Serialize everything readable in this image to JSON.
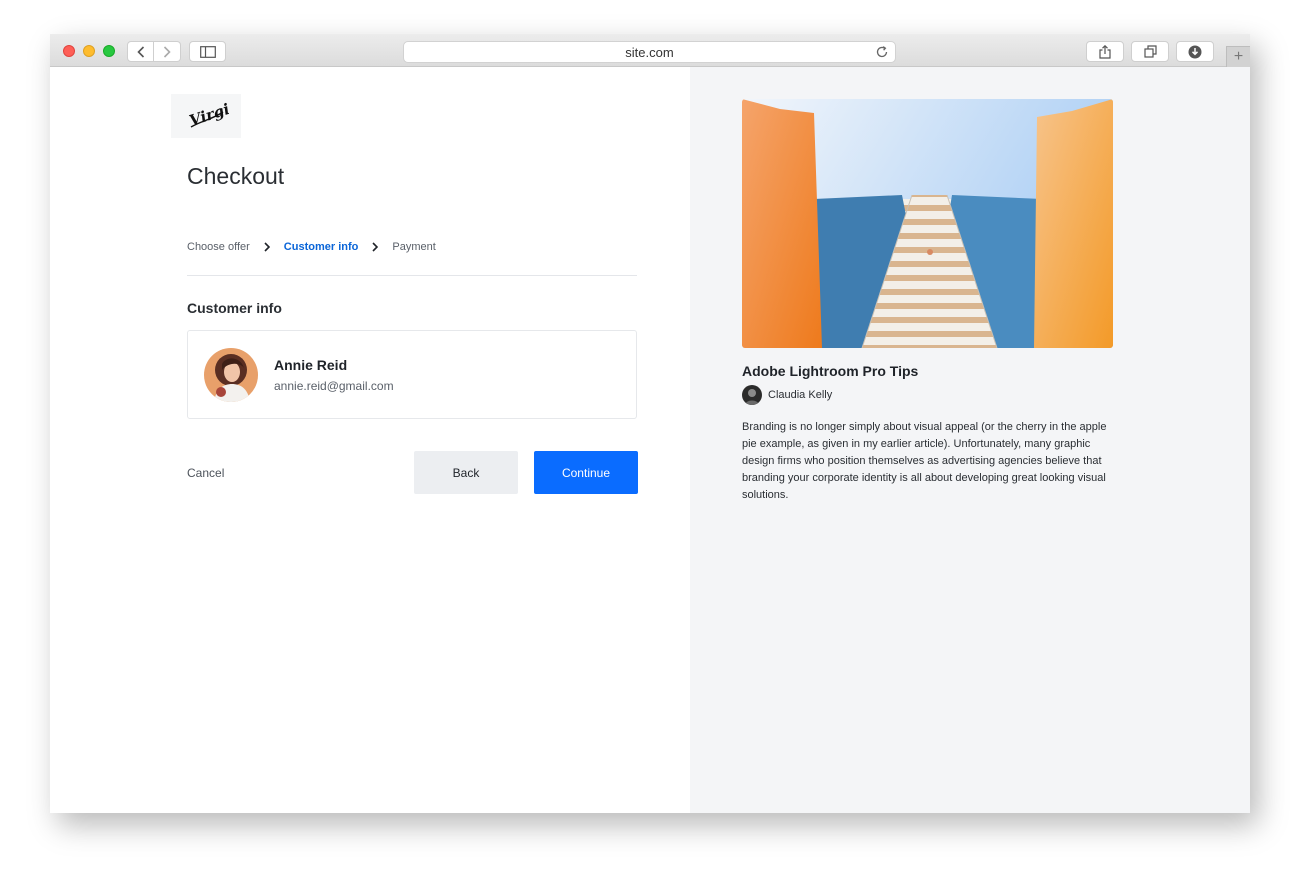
{
  "browser": {
    "url": "site.com",
    "new_tab_label": "+"
  },
  "brand": {
    "logo_text": "Virgin"
  },
  "checkout": {
    "title": "Checkout",
    "steps": [
      {
        "label": "Choose offer",
        "active": false
      },
      {
        "label": "Customer info",
        "active": true
      },
      {
        "label": "Payment",
        "active": false
      }
    ],
    "section_title": "Customer info",
    "customer": {
      "name": "Annie Reid",
      "email": "annie.reid@gmail.com"
    },
    "actions": {
      "cancel_label": "Cancel",
      "back_label": "Back",
      "continue_label": "Continue"
    }
  },
  "article": {
    "title": "Adobe Lightroom Pro Tips",
    "author": "Claudia Kelly",
    "body": "Branding is no longer simply about visual appeal (or the cherry in the apple pie example, as given in my earlier article). Unfortunately, many graphic design firms who position themselves as advertising agencies believe that branding your corporate identity is all about developing great looking visual solutions."
  },
  "colors": {
    "accent": "#0a6cff",
    "active_step": "#0a65d8",
    "right_pane_bg": "#f4f5f7"
  }
}
